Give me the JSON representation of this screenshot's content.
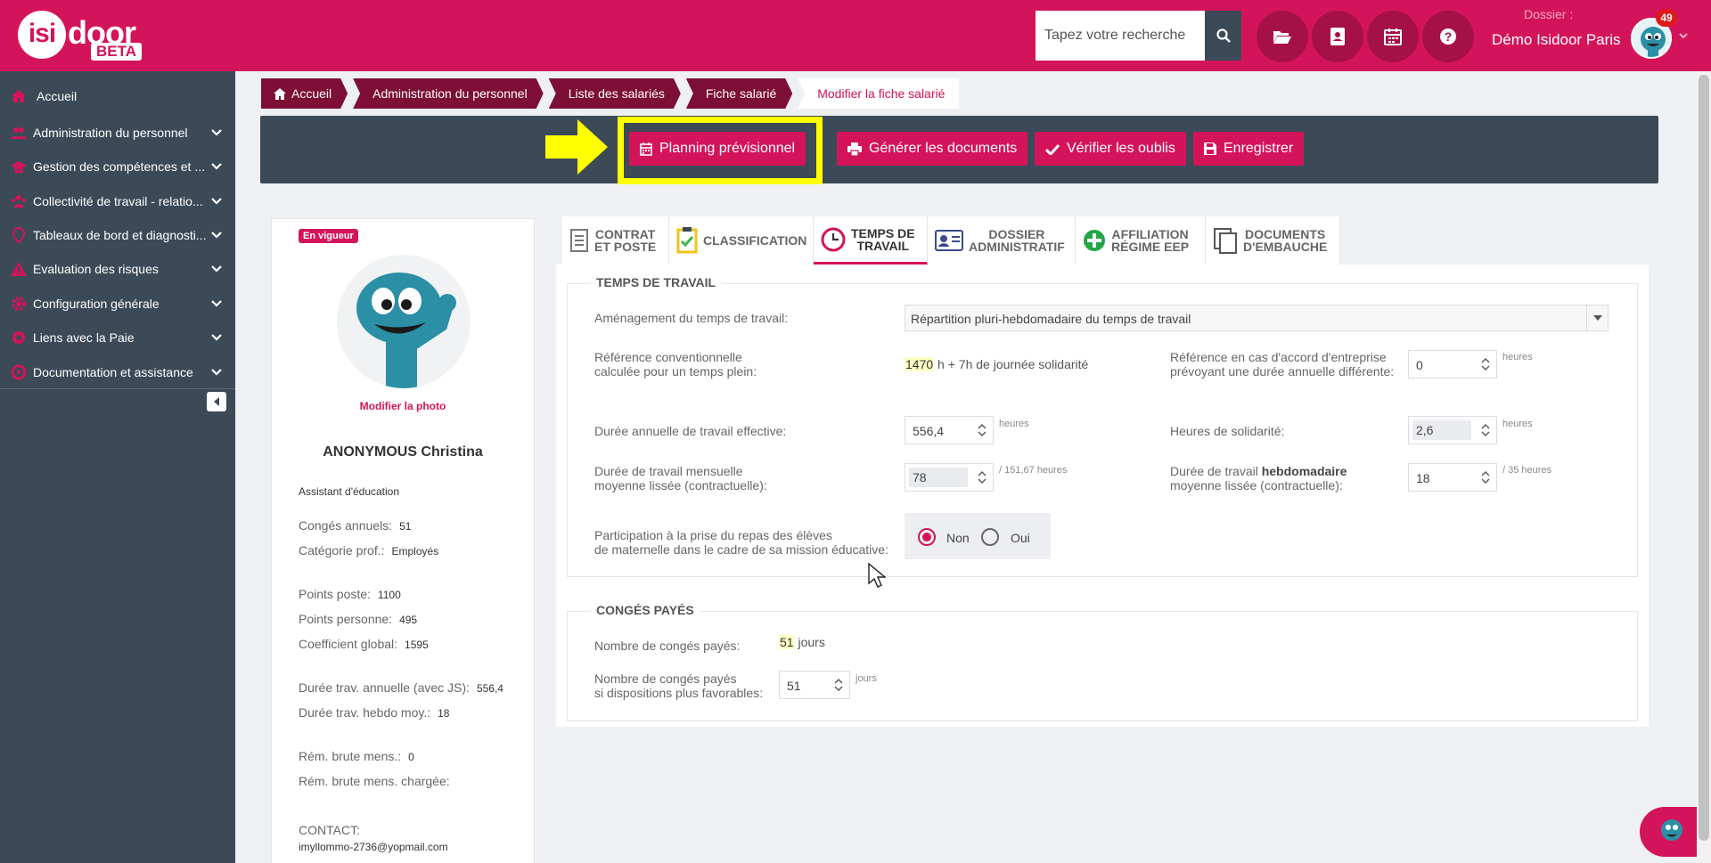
{
  "header": {
    "logo_isi": "isi",
    "logo_door": "door",
    "logo_beta": "BETA",
    "search_placeholder": "Tapez votre recherche",
    "dossier_label": "Dossier :",
    "dossier_name": "Démo Isidoor Paris",
    "notification_count": "49",
    "icons": [
      "folder-open-icon",
      "contact-card-icon",
      "calendar-icon",
      "help-icon"
    ]
  },
  "sidebar": {
    "items": [
      {
        "label": "Accueil",
        "icon": "home-icon"
      },
      {
        "label": "Administration du personnel",
        "icon": "users-icon"
      },
      {
        "label": "Gestion des compétences et ...",
        "icon": "graduation-icon"
      },
      {
        "label": "Collectivité de travail - relatio...",
        "icon": "group-icon"
      },
      {
        "label": "Tableaux de bord et diagnosti...",
        "icon": "dashboard-icon"
      },
      {
        "label": "Evaluation des risques",
        "icon": "warning-icon"
      },
      {
        "label": "Configuration générale",
        "icon": "gear-icon"
      },
      {
        "label": "Liens avec la Paie",
        "icon": "link-icon"
      },
      {
        "label": "Documentation et assistance",
        "icon": "lifebuoy-icon"
      }
    ]
  },
  "breadcrumb": [
    "Accueil",
    "Administration du personnel",
    "Liste des salariés",
    "Fiche salarié",
    "Modifier la fiche salarié"
  ],
  "actions": {
    "planning": "Planning prévisionnel",
    "generate": "Générer les documents",
    "verify": "Vérifier les oublis",
    "save": "Enregistrer"
  },
  "profile": {
    "status_badge": "En vigueur",
    "modify_photo": "Modifier la photo",
    "name": "ANONYMOUS Christina",
    "job": "Assistant d'éducation",
    "conges_label": "Congés annuels:",
    "conges_value": "51",
    "categorie_label": "Catégorie prof.:",
    "categorie_value": "Employés",
    "points_poste_label": "Points poste:",
    "points_poste_value": "1100",
    "points_personne_label": "Points personne:",
    "points_personne_value": "495",
    "coefficient_label": "Coefficient global:",
    "coefficient_value": "1595",
    "duree_annuelle_label": "Durée trav. annuelle (avec JS):",
    "duree_annuelle_value": "556,4",
    "duree_hebdo_label": "Durée trav. hebdo moy.:",
    "duree_hebdo_value": "18",
    "rem_brute_label": "Rém. brute mens.:",
    "rem_brute_value": "0",
    "rem_chargee_label": "Rém. brute mens. chargée:",
    "contact_label": "CONTACT:",
    "contact_email": "imyllommo-2736@yopmail.com"
  },
  "tabs": [
    {
      "l1": "CONTRAT",
      "l2": "ET POSTE",
      "icon": "document-icon"
    },
    {
      "l1": "CLASSIFICATION",
      "l2": "",
      "icon": "clipboard-check-icon"
    },
    {
      "l1": "TEMPS DE",
      "l2": "TRAVAIL",
      "icon": "clock-icon"
    },
    {
      "l1": "DOSSIER",
      "l2": "ADMINISTRATIF",
      "icon": "id-card-icon"
    },
    {
      "l1": "AFFILIATION",
      "l2": "RÉGIME EEP",
      "icon": "plus-circle-icon"
    },
    {
      "l1": "DOCUMENTS",
      "l2": "D'EMBAUCHE",
      "icon": "copy-icon"
    }
  ],
  "temps_travail": {
    "legend": "TEMPS DE TRAVAIL",
    "amenagement_label": "Aménagement du temps de travail:",
    "amenagement_value": "Répartition pluri-hebdomadaire du temps de travail",
    "reference_l1": "Référence conventionnelle",
    "reference_l2": "calculée pour un temps plein:",
    "reference_value": "1470",
    "reference_suffix": "h + 7h de journée solidarité",
    "accord_l1": "Référence en cas d'accord d'entreprise",
    "accord_l2": "prévoyant une durée annuelle différente:",
    "accord_value": "0",
    "heures": "heures",
    "duree_annuelle_label": "Durée annuelle de travail effective:",
    "duree_annuelle_value": "556,4",
    "solidarite_label": "Heures de solidarité:",
    "solidarite_value": "2,6",
    "mensuelle_l1": "Durée de travail mensuelle",
    "mensuelle_l2": "moyenne lissée (contractuelle):",
    "mensuelle_value": "78",
    "mensuelle_unit": "/ 151,67 heures",
    "hebdo_l1a": "Durée de travail",
    "hebdo_l1b": "hebdomadaire",
    "hebdo_l2": "moyenne lissée (contractuelle):",
    "hebdo_value": "18",
    "hebdo_unit": "/ 35 heures",
    "repas_l1": "Participation à la prise du repas des élèves",
    "repas_l2": "de maternelle dans le cadre de sa mission éducative:",
    "repas_non": "Non",
    "repas_oui": "Oui"
  },
  "conges": {
    "legend": "CONGÉS PAYÉS",
    "nombre_label": "Nombre de congés payés:",
    "nombre_value": "51",
    "nombre_unit": "jours",
    "favorables_l1": "Nombre de congés payés",
    "favorables_l2": "si dispositions plus favorables:",
    "favorables_value": "51",
    "favorables_unit": "jours"
  },
  "colors": {
    "brand": "#d4145a",
    "sidebar": "#3c4a57",
    "breadcrumb": "#7d0e35",
    "highlight": "#ffff00"
  }
}
